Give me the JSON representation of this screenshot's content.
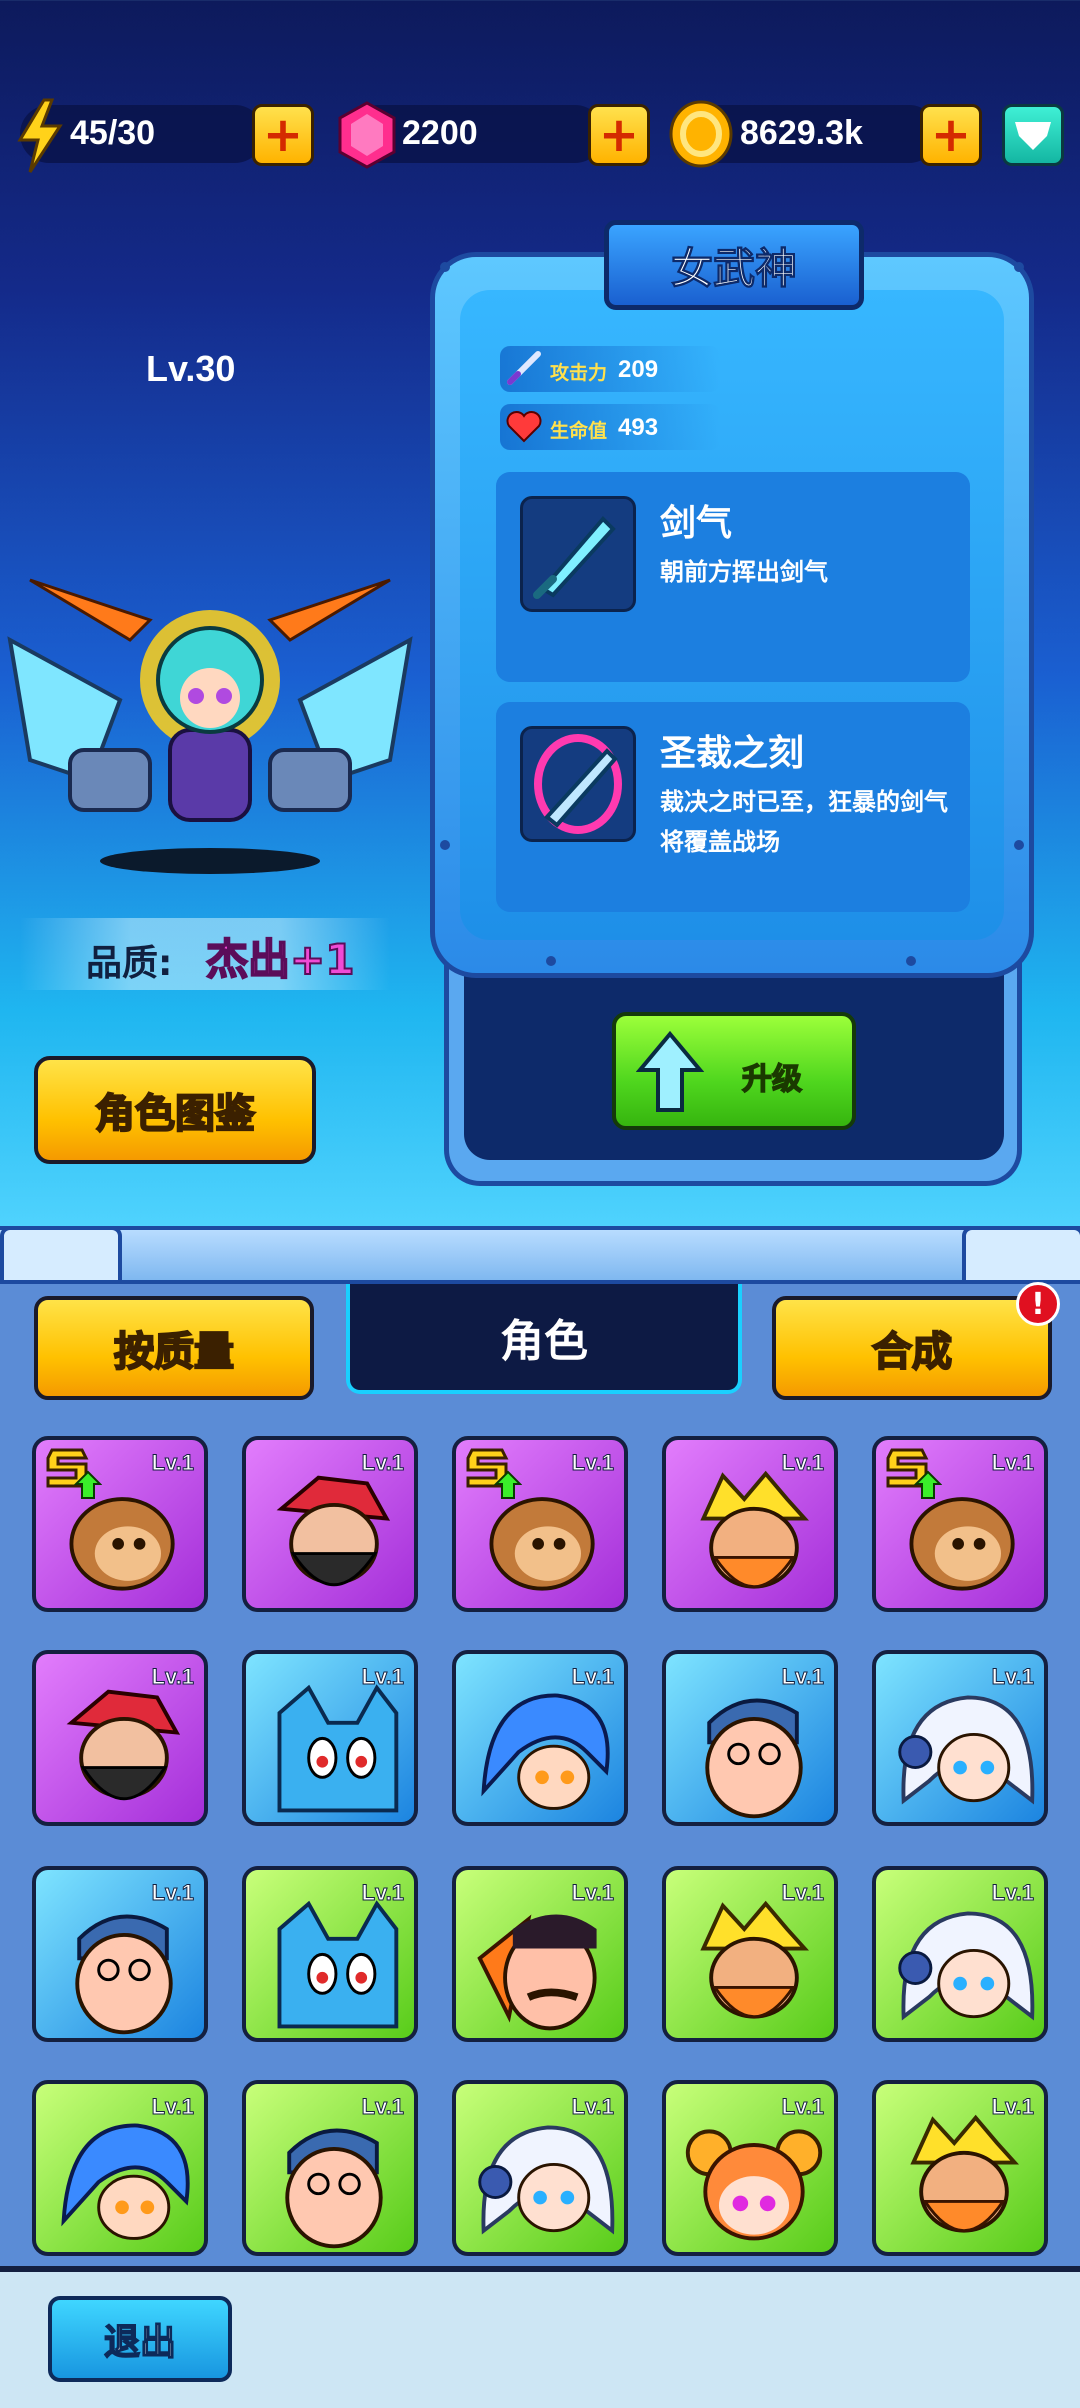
{
  "resources": {
    "energy": "45/30",
    "gems": "2200",
    "coins": "8629.3k"
  },
  "hero": {
    "level": "Lv.30",
    "name": "女武神",
    "quality_label": "品质:",
    "quality_value": "杰出+1",
    "stats": [
      {
        "name": "攻击力",
        "value": "209"
      },
      {
        "name": "生命值",
        "value": "493"
      }
    ],
    "skills": [
      {
        "name": "剑气",
        "desc": "朝前方挥出剑气"
      },
      {
        "name": "圣裁之刻",
        "desc": "裁决之时已至，狂暴的剑气将覆盖战场"
      }
    ]
  },
  "buttons": {
    "gallery": "角色图鉴",
    "upgrade": "升级",
    "sort": "按质量",
    "merge": "合成",
    "exit": "退出",
    "alert": "!"
  },
  "tab_title": "角色",
  "colors": {
    "purple_card": "#a42fd9",
    "blue_card": "#1c84e0",
    "green_card": "#58cc1a",
    "quality_text": "#f04bd6"
  },
  "roster": [
    {
      "rarity": "purple",
      "level": "Lv.1",
      "face": "monkey-face-icon",
      "s_rank": true
    },
    {
      "rarity": "purple",
      "level": "Lv.1",
      "face": "bearded-man-red-hair-icon",
      "s_rank": false
    },
    {
      "rarity": "purple",
      "level": "Lv.1",
      "face": "monkey-face-icon",
      "s_rank": true
    },
    {
      "rarity": "purple",
      "level": "Lv.1",
      "face": "yellow-hair-bearded-man-icon",
      "s_rank": false
    },
    {
      "rarity": "purple",
      "level": "Lv.1",
      "face": "monkey-face-icon",
      "s_rank": true
    },
    {
      "rarity": "purple",
      "level": "Lv.1",
      "face": "bearded-man-red-hair-icon",
      "s_rank": false
    },
    {
      "rarity": "blue",
      "level": "Lv.1",
      "face": "blue-cat-icon",
      "s_rank": false
    },
    {
      "rarity": "blue",
      "level": "Lv.1",
      "face": "blue-hair-girl-icon",
      "s_rank": false
    },
    {
      "rarity": "blue",
      "level": "Lv.1",
      "face": "glasses-man-icon",
      "s_rank": false
    },
    {
      "rarity": "blue",
      "level": "Lv.1",
      "face": "white-hair-girl-icon",
      "s_rank": false
    },
    {
      "rarity": "blue",
      "level": "Lv.1",
      "face": "glasses-man-icon",
      "s_rank": false
    },
    {
      "rarity": "green",
      "level": "Lv.1",
      "face": "blue-cat-icon",
      "s_rank": false
    },
    {
      "rarity": "green",
      "level": "Lv.1",
      "face": "mustache-man-icon",
      "s_rank": false
    },
    {
      "rarity": "green",
      "level": "Lv.1",
      "face": "yellow-hair-bearded-man-icon",
      "s_rank": false
    },
    {
      "rarity": "green",
      "level": "Lv.1",
      "face": "white-hair-girl-icon",
      "s_rank": false
    },
    {
      "rarity": "green",
      "level": "Lv.1",
      "face": "blue-hair-girl-icon",
      "s_rank": false
    },
    {
      "rarity": "green",
      "level": "Lv.1",
      "face": "glasses-man-icon",
      "s_rank": false
    },
    {
      "rarity": "green",
      "level": "Lv.1",
      "face": "white-hair-girl-icon",
      "s_rank": false
    },
    {
      "rarity": "green",
      "level": "Lv.1",
      "face": "bun-hair-girl-icon",
      "s_rank": false
    },
    {
      "rarity": "green",
      "level": "Lv.1",
      "face": "yellow-hair-bearded-man-icon",
      "s_rank": false
    }
  ]
}
